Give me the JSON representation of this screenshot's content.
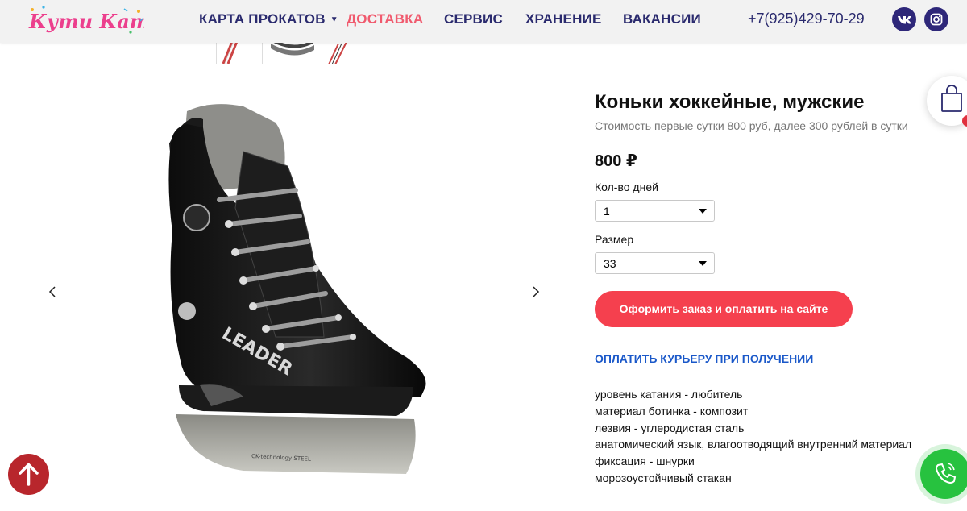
{
  "header": {
    "logo_text": "Кути Катай",
    "nav": [
      {
        "label": "КАРТА ПРОКАТОВ",
        "has_dropdown": true
      },
      {
        "label": "ДОСТАВКА",
        "active": true
      },
      {
        "label": "СЕРВИС"
      },
      {
        "label": "ХРАНЕНИЕ"
      },
      {
        "label": "ВАКАНСИИ"
      }
    ],
    "phone": "+7(925)429-70-29",
    "social": [
      "vk-icon",
      "instagram-icon"
    ]
  },
  "product": {
    "title": "Коньки хоккейные, мужские",
    "subtitle": "Стоимость первые сутки 800 руб, далее 300 рублей в сутки",
    "price": "800 ₽",
    "days_label": "Кол-во дней",
    "days_value": "1",
    "size_label": "Размер",
    "size_value": "33",
    "order_button": "Оформить заказ и оплатить на сайте",
    "courier_link": "ОПЛАТИТЬ КУРЬЕРУ ПРИ ПОЛУЧЕНИИ",
    "features": [
      "уровень катания - любитель",
      "материал ботинка - композит",
      "лезвия - углеродистая сталь",
      "анатомический язык, влагоотводящий внутренний материал",
      "фиксация - шнурки",
      "морозоустойчивый стакан"
    ],
    "image_brand": "LEADER",
    "blade_text": "CK-technology STEEL"
  },
  "colors": {
    "nav": "#2a2a6e",
    "nav_active": "#f05a6e",
    "order_button": "#f5404e",
    "link": "#1a58c9",
    "scroll_up": "#b8262c",
    "call": "#27c23f"
  }
}
